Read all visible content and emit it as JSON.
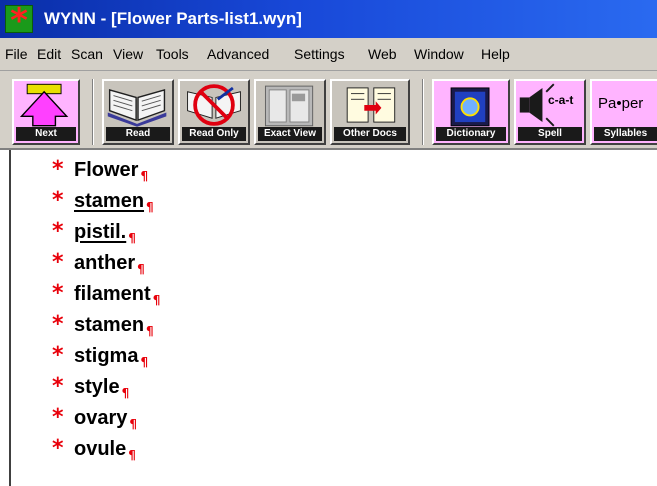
{
  "window": {
    "title": "WYNN - [Flower Parts-list1.wyn]",
    "app_icon": "wynn-star-icon",
    "accent_color": "#1848d8"
  },
  "menu": [
    {
      "label": "File"
    },
    {
      "label": "Edit"
    },
    {
      "label": "Scan"
    },
    {
      "label": "View"
    },
    {
      "label": "Tools"
    },
    {
      "label": "Advanced"
    },
    {
      "label": "Settings"
    },
    {
      "label": "Web"
    },
    {
      "label": "Window"
    },
    {
      "label": "Help"
    }
  ],
  "toolbar": [
    {
      "label": "Next",
      "icon": "next-arrow-icon"
    },
    {
      "label": "Read",
      "icon": "open-book-icon"
    },
    {
      "label": "Read Only",
      "icon": "read-only-icon"
    },
    {
      "label": "Exact View",
      "icon": "exact-view-icon"
    },
    {
      "label": "Other Docs",
      "icon": "other-docs-icon"
    },
    {
      "label": "Dictionary",
      "icon": "dictionary-icon"
    },
    {
      "label": "Spell",
      "icon": "speaker-spell-icon",
      "text": "c-a-t"
    },
    {
      "label": "Syllables",
      "icon": "syllables-icon",
      "text": "Pa•per"
    }
  ],
  "document": {
    "items": [
      {
        "text": "Flower",
        "underlined": false
      },
      {
        "text": "stamen",
        "underlined": true
      },
      {
        "text": "pistil.",
        "underlined": true
      },
      {
        "text": "anther",
        "underlined": false
      },
      {
        "text": "filament",
        "underlined": false
      },
      {
        "text": "stamen",
        "underlined": false
      },
      {
        "text": "stigma",
        "underlined": false
      },
      {
        "text": "style",
        "underlined": false
      },
      {
        "text": "ovary",
        "underlined": false
      },
      {
        "text": "ovule",
        "underlined": false
      }
    ],
    "bullet_color": "#e8000a"
  }
}
